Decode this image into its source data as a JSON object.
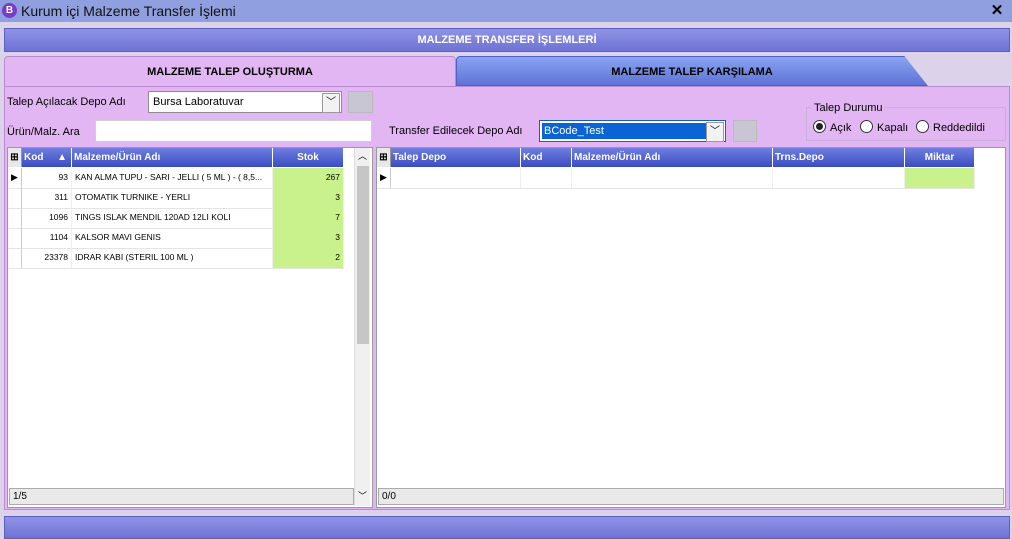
{
  "window": {
    "title": "Kurum içi Malzeme Transfer İşlemi",
    "icon_letter": "B",
    "close_label": "✕"
  },
  "header": {
    "title": "MALZEME TRANSFER İŞLEMLERİ"
  },
  "tabs": [
    {
      "label": "MALZEME TALEP OLUŞTURMA",
      "active": true
    },
    {
      "label": "MALZEME TALEP KARŞILAMA",
      "active": false
    }
  ],
  "form": {
    "depo_label": "Talep Açılacak Depo Adı",
    "depo_value": "Bursa Laboratuvar",
    "search_label": "Ürün/Malz. Ara",
    "search_value": "",
    "transfer_label": "Transfer Edilecek Depo Adı",
    "transfer_value": "BCode_Test"
  },
  "talep_durumu": {
    "legend": "Talep Durumu",
    "options": [
      "Açık",
      "Kapalı",
      "Reddedildi"
    ],
    "selected": "Açık"
  },
  "left_grid": {
    "columns": [
      "Kod",
      "Malzeme/Ürün Adı",
      "Stok"
    ],
    "rows": [
      {
        "kod": "93",
        "ad": "KAN ALMA TUPU - SARI - JELLI  ( 5 ML ) - ( 8,5...",
        "stok": "267"
      },
      {
        "kod": "311",
        "ad": "OTOMATIK TURNIKE - YERLI",
        "stok": "3"
      },
      {
        "kod": "1096",
        "ad": "TINGS ISLAK MENDIL 120AD 12LI KOLI",
        "stok": "7"
      },
      {
        "kod": "1104",
        "ad": "KALSOR MAVI GENIS",
        "stok": "3"
      },
      {
        "kod": "23378",
        "ad": "IDRAR KABI (STERIL 100 ML )",
        "stok": "2"
      }
    ],
    "footer": "1/5"
  },
  "right_grid": {
    "columns": [
      "Talep Depo",
      "Kod",
      "Malzeme/Ürün Adı",
      "Trns.Depo",
      "Miktar"
    ],
    "footer": "0/0"
  },
  "colors": {
    "accent": "#5a6ad6",
    "panel": "#e2b6f3",
    "stock_cell": "#c9f18c"
  }
}
